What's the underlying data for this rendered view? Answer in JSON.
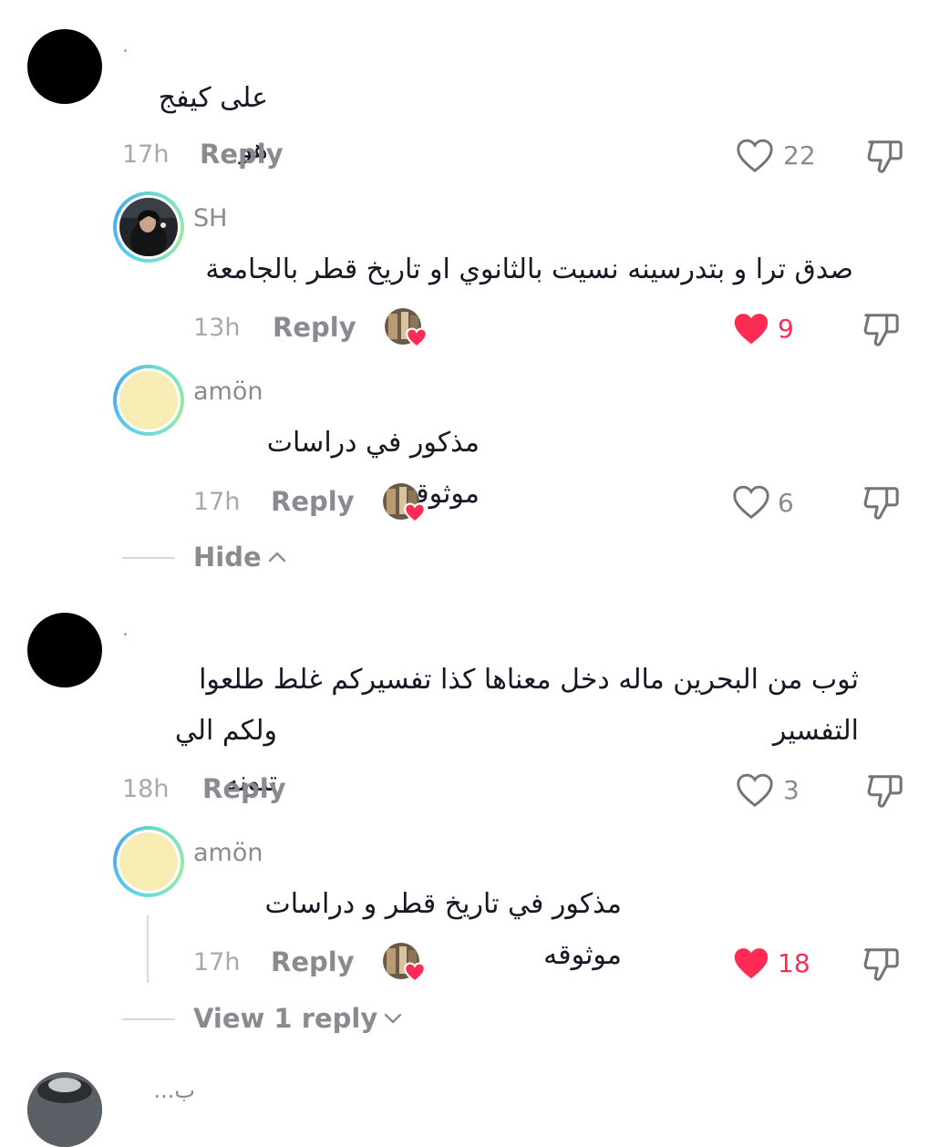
{
  "comments": [
    {
      "name": ".",
      "text": "على كيفج هو",
      "time": "17h",
      "reply": "Reply",
      "likes": "22",
      "replies": [
        {
          "name": "SH",
          "text": "صدق ترا و بتدرسينه نسيت بالثانوي او تاريخ قطر بالجامعة",
          "time": "13h",
          "reply": "Reply",
          "likes": "9",
          "liked": true
        },
        {
          "name": "amön",
          "text": "مذكور في دراسات موثوقه",
          "time": "17h",
          "reply": "Reply",
          "likes": "6",
          "liked": false
        }
      ],
      "toggle": "Hide"
    },
    {
      "name": ".",
      "text_line1": "ثوب من البحرين ماله دخل معناها كذا تفسيركم غلط طلعوا التفسير",
      "text_line2": "ولكم الي تبونه",
      "time": "18h",
      "reply": "Reply",
      "likes": "3",
      "replies": [
        {
          "name": "amön",
          "text": "مذكور في تاريخ قطر و دراسات موثوقه",
          "time": "17h",
          "reply": "Reply",
          "likes": "18",
          "liked": true
        }
      ],
      "toggle": "View 1 reply"
    }
  ],
  "partial_next": {
    "name": "ب..."
  },
  "colors": {
    "like_red": "#fe2c55",
    "muted": "#8a8b91",
    "text": "#161823"
  },
  "icons": [
    "heart-outline-icon",
    "heart-filled-icon",
    "thumbs-down-icon",
    "chevron-up-icon",
    "chevron-down-icon",
    "creator-liked-avatar"
  ]
}
